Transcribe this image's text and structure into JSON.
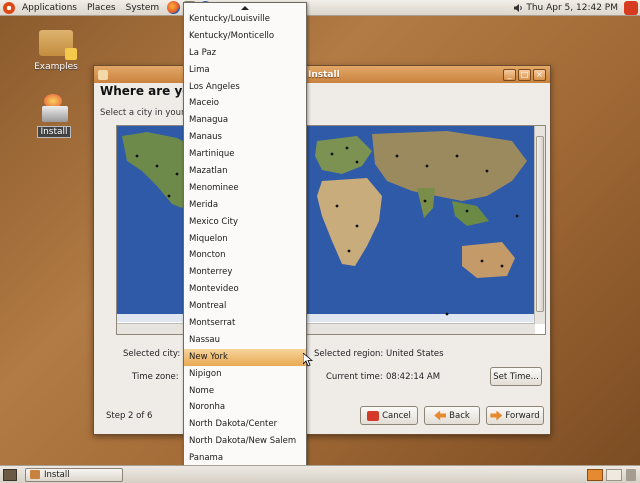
{
  "top_panel": {
    "menus": [
      "Applications",
      "Places",
      "System"
    ],
    "clock": "Thu Apr  5, 12:42 PM"
  },
  "desktop_icons": {
    "examples": "Examples",
    "install": "Install"
  },
  "window": {
    "title": "Install",
    "heading": "Where are you?",
    "instruction": "Select a city in your country and time zone.",
    "selected_city_label": "Selected city:",
    "selected_region_label": "Selected region:",
    "selected_region_value": "United States",
    "time_zone_label": "Time zone:",
    "current_time_label": "Current time:",
    "current_time_value": "08:42:14 AM",
    "set_time_label": "Set Time...",
    "step_text": "Step 2 of 6",
    "cancel_label": "Cancel",
    "back_label": "Back",
    "forward_label": "Forward"
  },
  "city_list": {
    "items": [
      "Kentucky/Louisville",
      "Kentucky/Monticello",
      "La Paz",
      "Lima",
      "Los Angeles",
      "Maceio",
      "Managua",
      "Manaus",
      "Martinique",
      "Mazatlan",
      "Menominee",
      "Merida",
      "Mexico City",
      "Miquelon",
      "Moncton",
      "Monterrey",
      "Montevideo",
      "Montreal",
      "Montserrat",
      "Nassau",
      "New York",
      "Nipigon",
      "Nome",
      "Noronha",
      "North Dakota/Center",
      "North Dakota/New Salem",
      "Panama"
    ],
    "selected": "New York"
  },
  "taskbar": {
    "task_label": "Install"
  },
  "colors": {
    "accent": "#e9a954",
    "titlebar": "#c9823e",
    "ocean": "#2f5aa8"
  }
}
